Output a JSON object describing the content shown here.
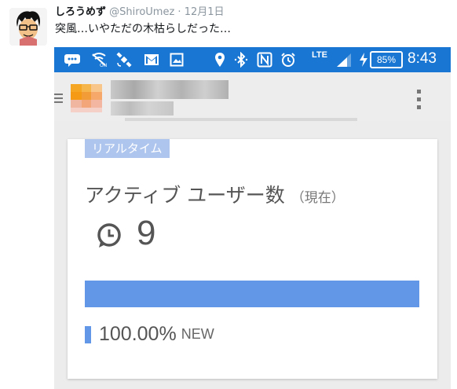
{
  "tweet": {
    "display_name": "しろうめず",
    "handle": "@ShiroUmez",
    "separator": "·",
    "date": "12月1日",
    "text": "突風…いやただの木枯らしだった…"
  },
  "statusbar": {
    "lte": "LTE",
    "battery": "85%",
    "time": "8:43",
    "icons": [
      "hangouts-icon",
      "signal-off-icon",
      "gps-icon",
      "gmail-icon",
      "image-icon",
      "location-icon",
      "bluetooth-icon",
      "nfc-icon",
      "alarm-icon",
      "cell-signal-icon",
      "charging-icon",
      "battery-icon"
    ]
  },
  "card": {
    "tag": "リアルタイム",
    "metric_title": "アクティブ ユーザー数",
    "metric_subtitle": "（現在）",
    "active_count": "9",
    "bar_fraction": 1.0,
    "legend_percent": "100.00%",
    "legend_label": "NEW"
  },
  "colors": {
    "statusbar": "#1976d2",
    "accent": "#6297e8",
    "tag_bg": "#aec5ee"
  }
}
